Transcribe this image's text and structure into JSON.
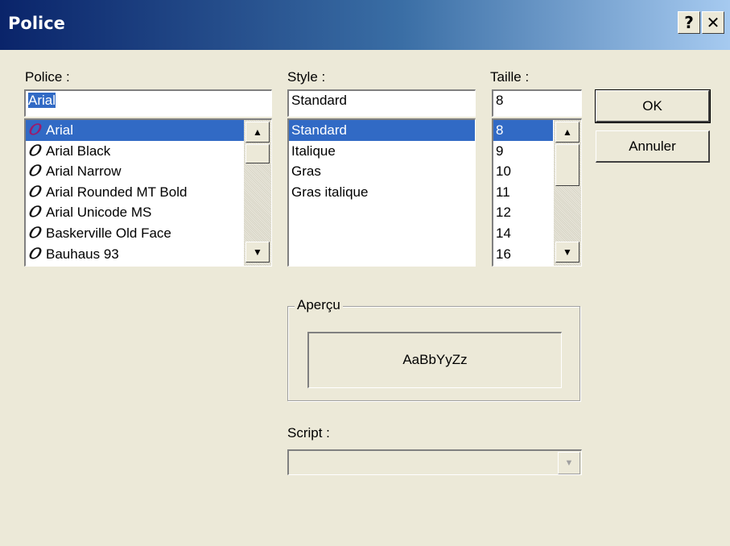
{
  "window": {
    "title": "Police",
    "help_label": "?",
    "close_label": "✕"
  },
  "font": {
    "label": "Police :",
    "value": "Arial",
    "items": [
      {
        "icon": "𝑂",
        "label": "Arial"
      },
      {
        "icon": "𝑂",
        "label": "Arial Black"
      },
      {
        "icon": "𝑂",
        "label": "Arial Narrow"
      },
      {
        "icon": "𝑂",
        "label": "Arial Rounded MT Bold"
      },
      {
        "icon": "𝑂",
        "label": "Arial Unicode MS"
      },
      {
        "icon": "𝑂",
        "label": "Baskerville Old Face"
      },
      {
        "icon": "𝑂",
        "label": "Bauhaus 93"
      }
    ]
  },
  "style": {
    "label": "Style :",
    "value": "Standard",
    "items": [
      "Standard",
      "Italique",
      "Gras",
      "Gras italique"
    ]
  },
  "size": {
    "label": "Taille :",
    "value": "8",
    "items": [
      "8",
      "9",
      "10",
      "11",
      "12",
      "14",
      "16"
    ]
  },
  "buttons": {
    "ok": "OK",
    "cancel": "Annuler"
  },
  "preview": {
    "label": "Aperçu",
    "sample": "AaBbYyZz"
  },
  "script": {
    "label": "Script :",
    "value": ""
  },
  "scroll": {
    "up": "▲",
    "down": "▼"
  }
}
